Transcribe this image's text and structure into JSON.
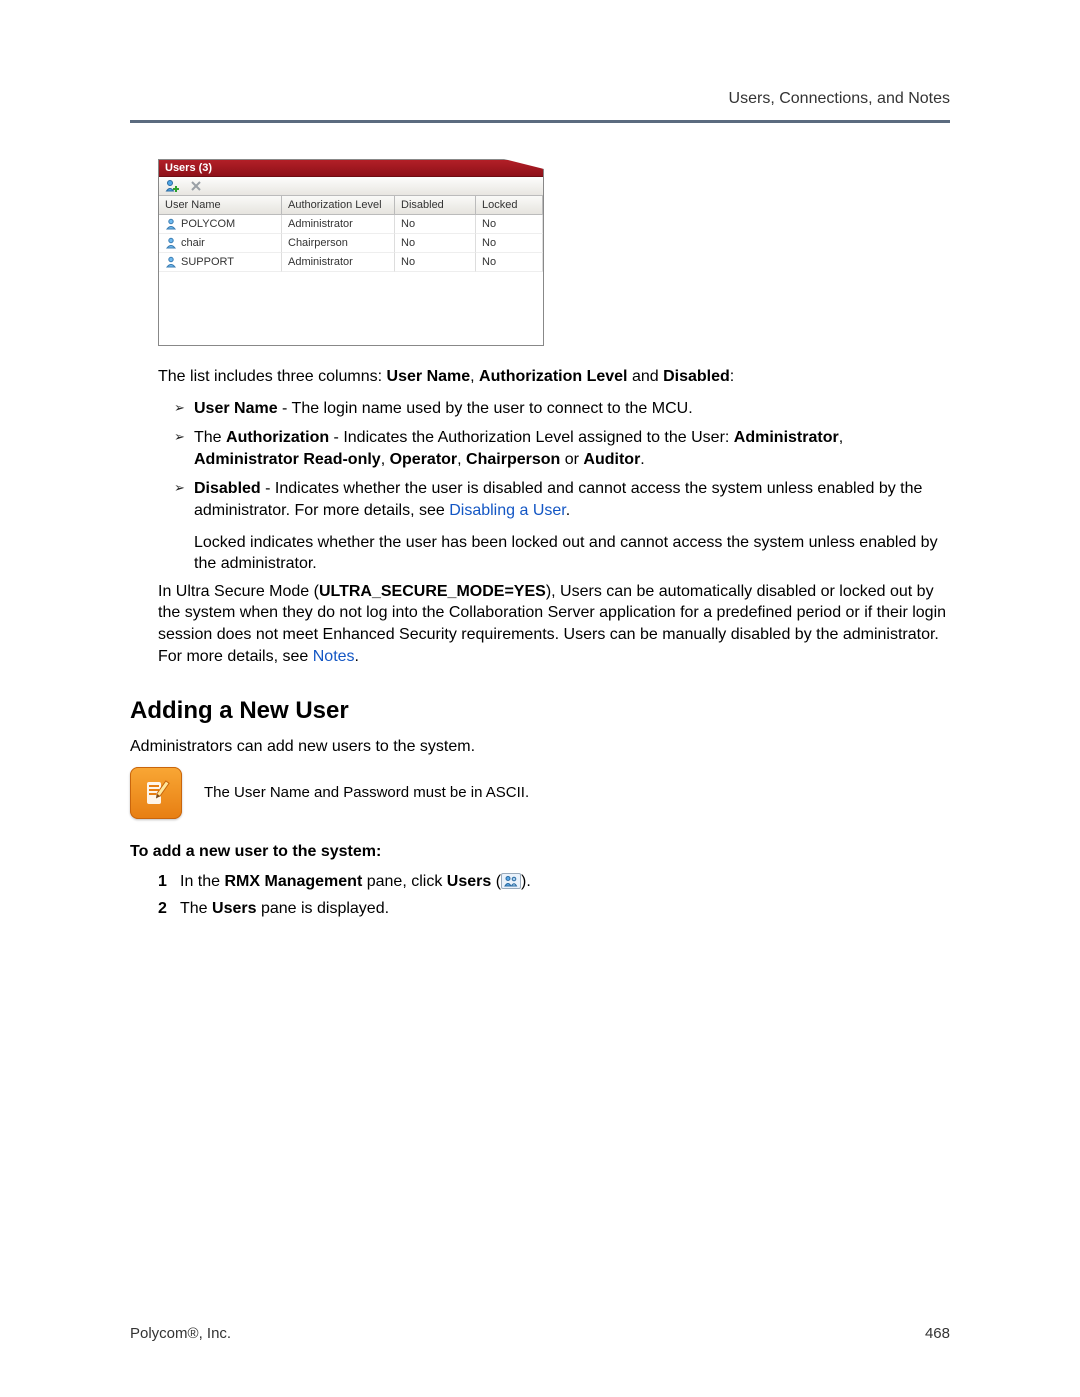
{
  "header": {
    "section": "Users, Connections, and Notes"
  },
  "pane": {
    "title": "Users (3)",
    "columns": [
      "User Name",
      "Authorization Level",
      "Disabled",
      "Locked"
    ],
    "rows": [
      {
        "name": "POLYCOM",
        "auth": "Administrator",
        "disabled": "No",
        "locked": "No"
      },
      {
        "name": "chair",
        "auth": "Chairperson",
        "disabled": "No",
        "locked": "No"
      },
      {
        "name": "SUPPORT",
        "auth": "Administrator",
        "disabled": "No",
        "locked": "No"
      }
    ]
  },
  "txt": {
    "columns_intro_a": "The list includes three columns: ",
    "columns_intro_b": "User Name",
    "columns_intro_c": ", ",
    "columns_intro_d": "Authorization Level",
    "columns_intro_e": " and ",
    "columns_intro_f": "Disabled",
    "columns_intro_g": ":",
    "b1_a": "User Name",
    "b1_b": " - The login name used by the user to connect to the MCU.",
    "b2_a": "The ",
    "b2_b": "Authorization",
    "b2_c": " - Indicates the Authorization Level assigned to the User: ",
    "b2_d": "Administrator",
    "b2_e": ", ",
    "b2_f": "Administrator Read-only",
    "b2_g": ", ",
    "b2_h": "Operator",
    "b2_i": ", ",
    "b2_j": "Chairperson",
    "b2_k": " or ",
    "b2_l": "Auditor",
    "b2_m": ".",
    "b3_a": "Disabled",
    "b3_b": " - Indicates whether the user is disabled and cannot access the system unless enabled by the administrator. For more details, see ",
    "b3_link": "Disabling a User",
    "b3_c": ".",
    "locked_para": "Locked indicates whether the user has been locked out and cannot access the system unless enabled by the administrator.",
    "secure_a": "In Ultra Secure Mode (",
    "secure_b": "ULTRA_SECURE_MODE=YES",
    "secure_c": "), Users can be automatically disabled or locked out by the system when they do not log into the Collaboration Server application for a predefined period or if their login session does not meet Enhanced Security requirements. Users can be manually disabled by the administrator. For more details, see ",
    "secure_link": "Notes",
    "secure_d": "."
  },
  "adding": {
    "heading": "Adding a New User",
    "intro": "Administrators can add new users to the system.",
    "note": "The User Name and Password must be in ASCII.",
    "subhead": "To add a new user to the system:",
    "step1_a": "In the ",
    "step1_b": "RMX Management",
    "step1_c": " pane, click ",
    "step1_d": "Users",
    "step1_e": " (",
    "step1_f": ").",
    "step2_a": "The ",
    "step2_b": "Users",
    "step2_c": " pane is displayed."
  },
  "footer": {
    "left": "Polycom®, Inc.",
    "page": "468"
  }
}
